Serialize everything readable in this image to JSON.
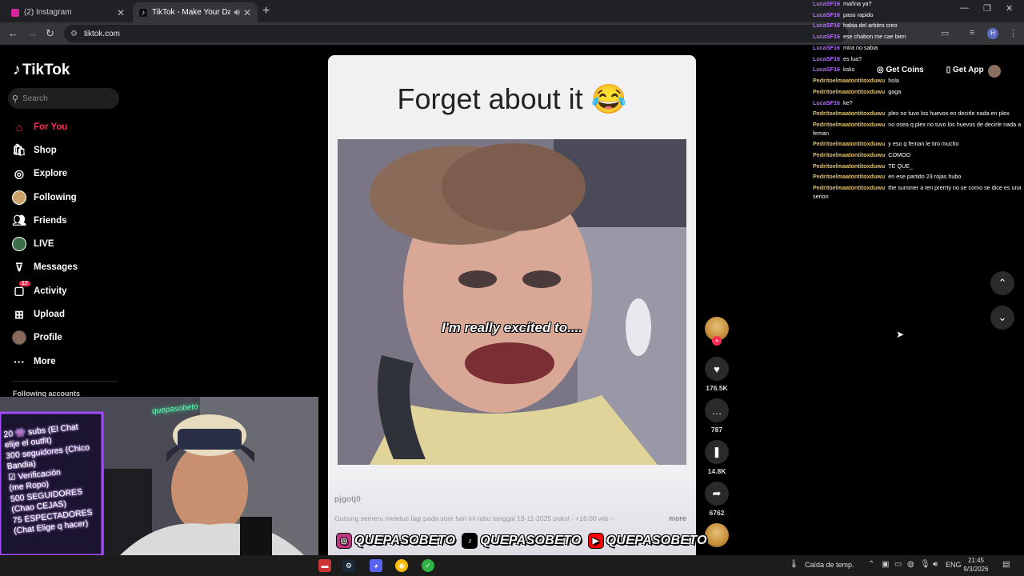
{
  "browser": {
    "tabs": [
      {
        "label": "(2) Instagram"
      },
      {
        "label": "TikTok - Make Your Day"
      }
    ],
    "url": "tiktok.com"
  },
  "tiktok": {
    "logo": "TikTok",
    "search_placeholder": "Search",
    "nav": [
      {
        "label": "For You",
        "icon": "home-icon"
      },
      {
        "label": "Shop",
        "icon": "shop-icon"
      },
      {
        "label": "Explore",
        "icon": "compass-icon"
      },
      {
        "label": "Following",
        "icon": "avatar"
      },
      {
        "label": "Friends",
        "icon": "friends-icon"
      },
      {
        "label": "LIVE",
        "icon": "live-icon"
      },
      {
        "label": "Messages",
        "icon": "messages-icon"
      },
      {
        "label": "Activity",
        "icon": "activity-icon",
        "badge": "17"
      },
      {
        "label": "Upload",
        "icon": "upload-icon"
      },
      {
        "label": "Profile",
        "icon": "avatar"
      },
      {
        "label": "More",
        "icon": "more-icon"
      }
    ],
    "following_accounts": "Following accounts",
    "get_coins": "Get Coins",
    "get_app": "Get App"
  },
  "video": {
    "title": "Forget about it 😂",
    "subtitle": "I'm really excited to....",
    "author": "pjgotj0",
    "description": "Gunung semeru meletus lagi pada sore hari ini rabu tanggal 19-11-2025 pukul - +16:00 wib --",
    "more_label": "more",
    "likes": "176.5K",
    "comments": "787",
    "bookmarks": "14.8K",
    "shares": "6762"
  },
  "chat": [
    {
      "user": "LucaSF16",
      "msg": "mañna ya?"
    },
    {
      "user": "LucaSF16",
      "msg": "paso rapido"
    },
    {
      "user": "LucaSF16",
      "msg": "habia del arbitro creo"
    },
    {
      "user": "LucaSF16",
      "msg": "ese chabon me cae bien"
    },
    {
      "user": "LucaSF16",
      "msg": "mira no sabia"
    },
    {
      "user": "LucaSF16",
      "msg": "es lua?"
    },
    {
      "user": "LucaSF16",
      "msg": "ksks"
    },
    {
      "user": "Pedritoelmaatontitoxduwu",
      "msg": "hola"
    },
    {
      "user": "Pedritoelmaatontitoxduwu",
      "msg": "gaga"
    },
    {
      "user": "LucaSF16",
      "msg": "ke?"
    },
    {
      "user": "Pedritoelmaatontitoxduwu",
      "msg": "plex no tuvo los huevos en decirle nada en plex"
    },
    {
      "user": "Pedritoelmaatontitoxduwu",
      "msg": "no osea q plex no tuvo los huevos de decirle nada a feman"
    },
    {
      "user": "Pedritoelmaatontitoxduwu",
      "msg": "y eso q feman le tiro mucho"
    },
    {
      "user": "Pedritoelmaatontitoxduwu",
      "msg": "COMOO"
    },
    {
      "user": "Pedritoelmaatontitoxduwu",
      "msg": "TE QUE_"
    },
    {
      "user": "Pedritoelmaatontitoxduwu",
      "msg": "en ese partido 23 rojas hubo"
    },
    {
      "user": "Pedritoelmaatontitoxduwu",
      "msg": "the summer a ten prerrty no se como se dice es una serion"
    }
  ],
  "webcam": {
    "neon_sign": "quepasobeto",
    "board_lines": [
      "20 👾 subs (El Chat",
      "elije el outfit)",
      "300 seguidores (Chico",
      "Bandia)",
      "☑ Verificación",
      "(me Ropo)",
      "500 SEGUIDORES",
      "(Chao CEJAS)",
      "75 ESPECTADORES",
      "(Chat Elige q hacer)"
    ]
  },
  "banner": {
    "handles": [
      "QUEPASOBETO",
      "QUEPASOBETO",
      "QUEPASOBETO"
    ],
    "colors": {
      "instagram": "#c13584",
      "tiktok": "#000000",
      "youtube": "#ff0000"
    }
  },
  "taskbar": {
    "weather": "Caída de temp.",
    "lang": "ENG",
    "time": "21:45",
    "date": "9/3/2026"
  },
  "colors": {
    "accent": "#fe2c55",
    "luca": "#b36cff",
    "pedro": "#e0c06a"
  }
}
